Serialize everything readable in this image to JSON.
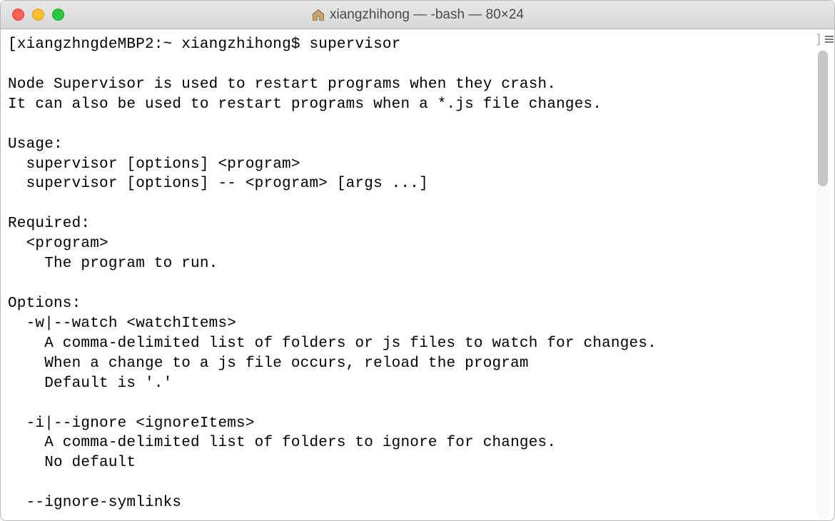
{
  "window": {
    "title": "xiangzhihong — -bash — 80×24"
  },
  "terminal": {
    "prompt_open": "[",
    "host": "xiangzhngdeMBP2",
    "sep1": ":~ ",
    "user": "xiangzhihong",
    "prompt_symbol": "$ ",
    "command": "supervisor",
    "lines": {
      "l0": "",
      "l1": "Node Supervisor is used to restart programs when they crash.",
      "l2": "It can also be used to restart programs when a *.js file changes.",
      "l3": "",
      "l4": "Usage:",
      "l5": "  supervisor [options] <program>",
      "l6": "  supervisor [options] -- <program> [args ...]",
      "l7": "",
      "l8": "Required:",
      "l9": "  <program>",
      "l10": "    The program to run.",
      "l11": "",
      "l12": "Options:",
      "l13": "  -w|--watch <watchItems>",
      "l14": "    A comma-delimited list of folders or js files to watch for changes.",
      "l15": "    When a change to a js file occurs, reload the program",
      "l16": "    Default is '.'",
      "l17": "",
      "l18": "  -i|--ignore <ignoreItems>",
      "l19": "    A comma-delimited list of folders to ignore for changes.",
      "l20": "    No default",
      "l21": "",
      "l22": "  --ignore-symlinks"
    }
  },
  "gutter": {
    "bracket": "]"
  }
}
